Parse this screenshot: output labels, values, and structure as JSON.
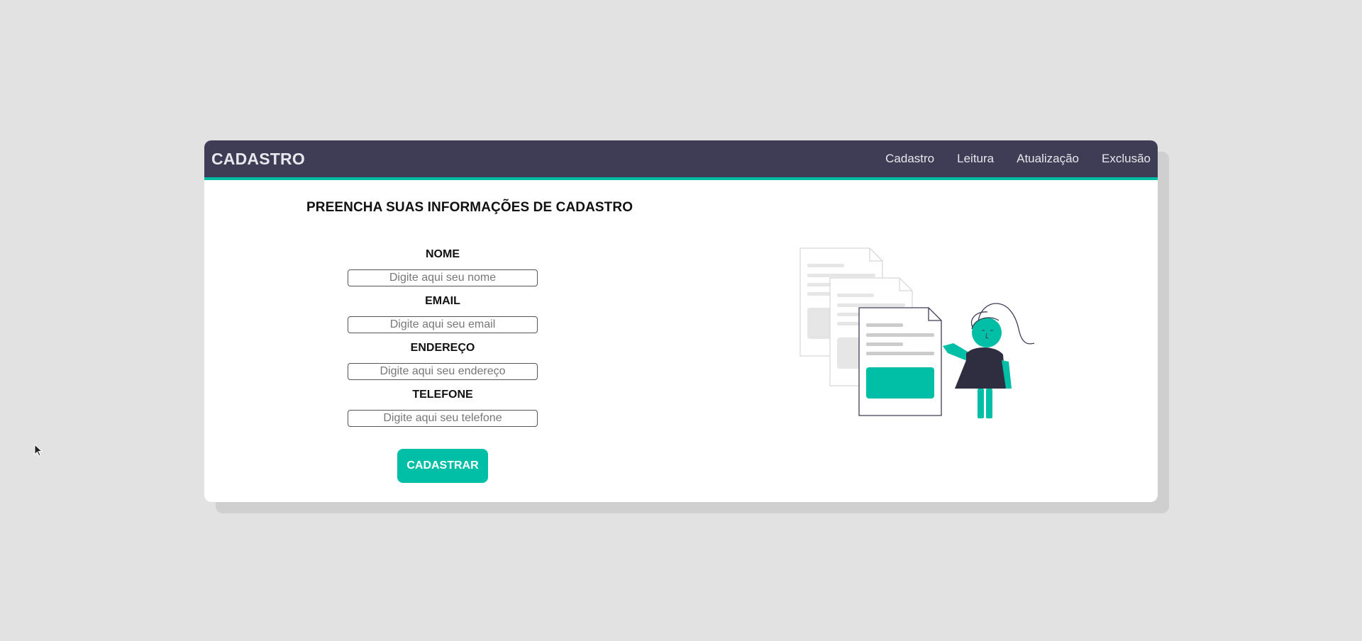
{
  "header": {
    "brand": "CADASTRO",
    "nav": [
      {
        "label": "Cadastro"
      },
      {
        "label": "Leitura"
      },
      {
        "label": "Atualização"
      },
      {
        "label": "Exclusão"
      }
    ]
  },
  "form": {
    "title": "PREENCHA SUAS INFORMAÇÕES DE CADASTRO",
    "fields": [
      {
        "label": "NOME",
        "placeholder": "Digite aqui seu nome",
        "value": ""
      },
      {
        "label": "EMAIL",
        "placeholder": "Digite aqui seu email",
        "value": ""
      },
      {
        "label": "ENDEREÇO",
        "placeholder": "Digite aqui seu endereço",
        "value": ""
      },
      {
        "label": "TELEFONE",
        "placeholder": "Digite aqui seu telefone",
        "value": ""
      }
    ],
    "submit_label": "CADASTRAR"
  },
  "colors": {
    "navbar": "#3f3d56",
    "accent": "#00bfa6",
    "background": "#e2e2e2",
    "card": "#ffffff"
  },
  "illustration": {
    "icon": "document-form-illustration"
  }
}
